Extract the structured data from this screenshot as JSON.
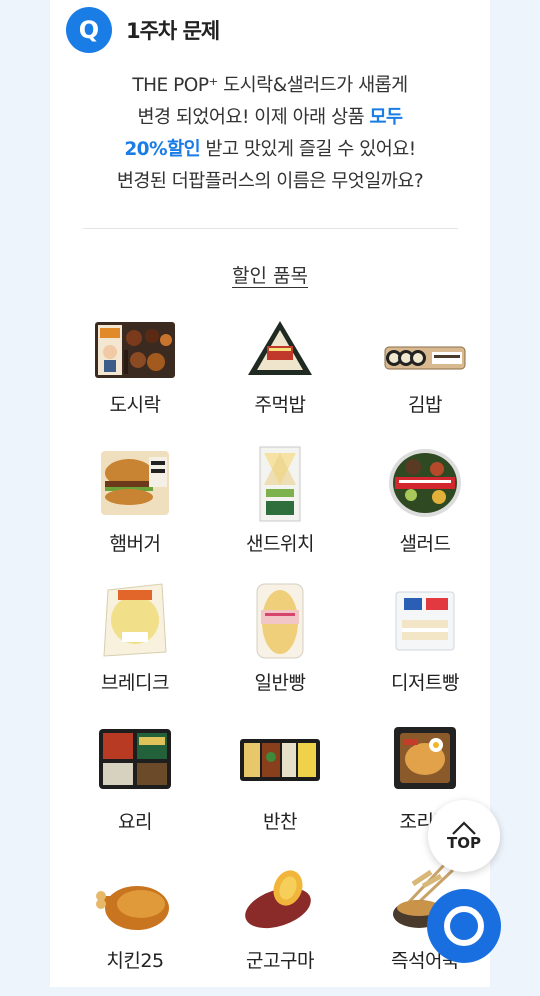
{
  "header": {
    "badge": "Q",
    "title": "1주차 문제"
  },
  "question": {
    "line1": "THE POP⁺ 도시락&샐러드가 새롭게",
    "line2_a": "변경 되었어요! 이제 아래 상품 ",
    "line2_b": "모두",
    "line3_a": "20%할인",
    "line3_b": " 받고 맛있게 즐길 수 있어요!",
    "line4": "변경된 더팝플러스의 이름은 무엇일까요?"
  },
  "list_title": "할인 품목",
  "items": [
    {
      "label": "도시락",
      "icon": "lunchbox-image"
    },
    {
      "label": "주먹밥",
      "icon": "rice-ball-image"
    },
    {
      "label": "김밥",
      "icon": "gimbap-image"
    },
    {
      "label": "햄버거",
      "icon": "hamburger-image"
    },
    {
      "label": "샌드위치",
      "icon": "sandwich-image"
    },
    {
      "label": "샐러드",
      "icon": "salad-image"
    },
    {
      "label": "브레디크",
      "icon": "bread-pack-image"
    },
    {
      "label": "일반빵",
      "icon": "bread-image"
    },
    {
      "label": "디저트빵",
      "icon": "dessert-bread-image"
    },
    {
      "label": "요리",
      "icon": "dish-image"
    },
    {
      "label": "반찬",
      "icon": "side-dish-image"
    },
    {
      "label": "조리면",
      "icon": "noodles-image"
    },
    {
      "label": "치킨25",
      "icon": "fried-chicken-image"
    },
    {
      "label": "군고구마",
      "icon": "sweet-potato-image"
    },
    {
      "label": "즉석어묵",
      "icon": "fish-cake-image"
    }
  ],
  "top_button": {
    "label": "TOP",
    "icon": "chevron-up-icon"
  },
  "fab": {
    "icon": "circle-icon"
  },
  "colors": {
    "accent": "#1a7de6",
    "fab": "#1a6fe0",
    "background": "#eef4fb"
  }
}
